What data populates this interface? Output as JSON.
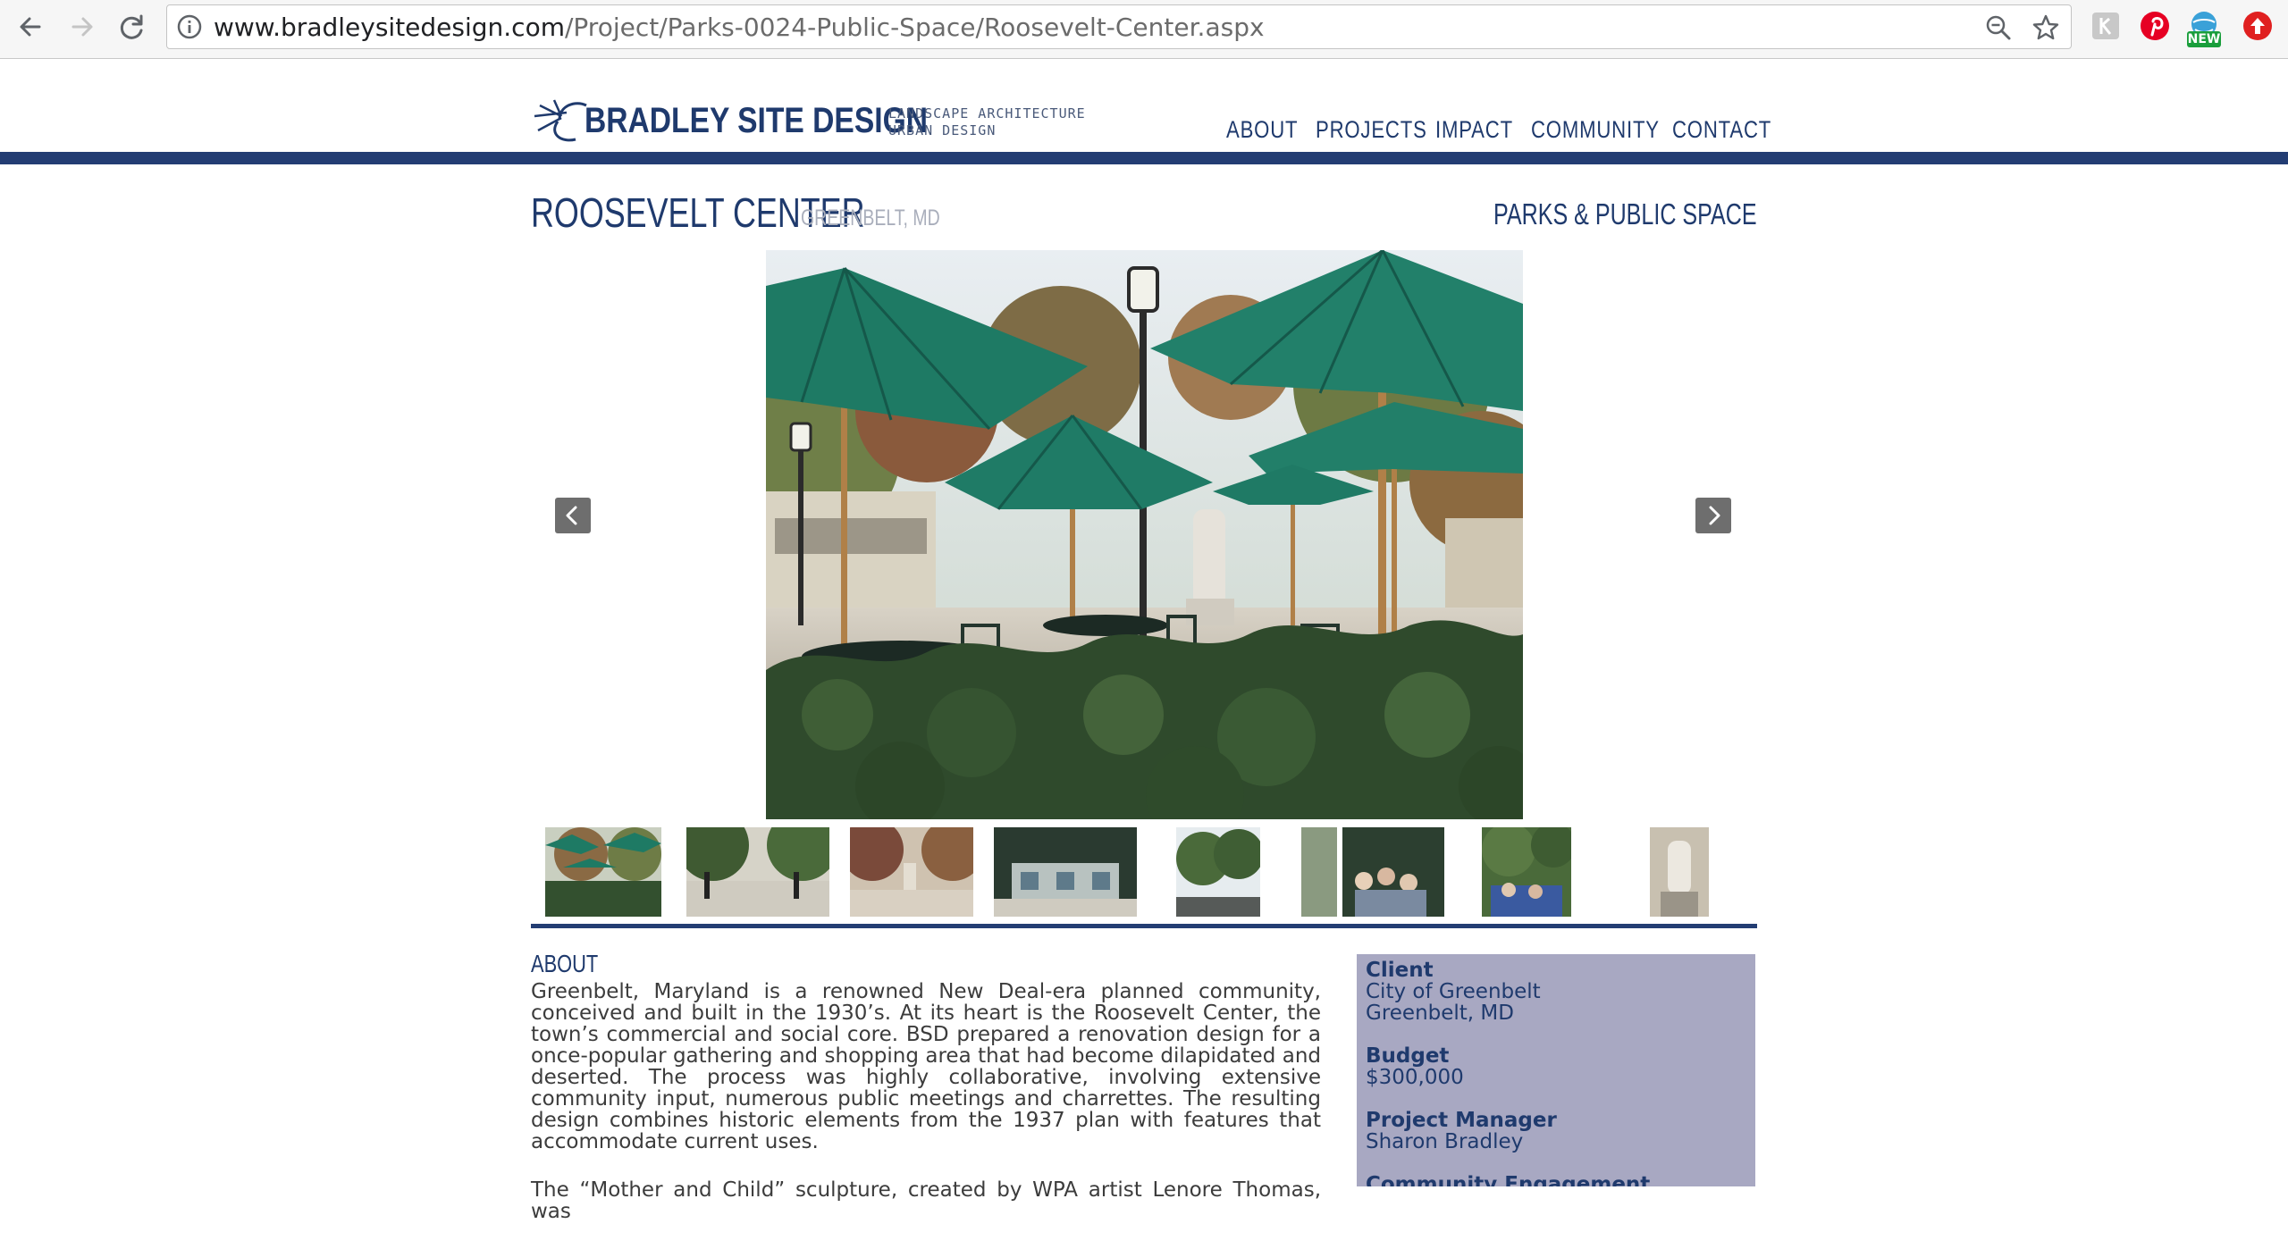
{
  "browser": {
    "url_host": "www.bradleysitedesign.com",
    "url_path": "/Project/Parks-0024-Public-Space/Roosevelt-Center.aspx",
    "extension_badge": "NEW"
  },
  "site": {
    "logo_name": "BRADLEY SITE DESIGN",
    "logo_tag_line1": "LANDSCAPE ARCHITECTURE",
    "logo_tag_line2": "URBAN DESIGN",
    "nav": [
      "ABOUT",
      "PROJECTS",
      "IMPACT",
      "COMMUNITY",
      "CONTACT"
    ],
    "accent_color": "#233d73"
  },
  "project": {
    "title": "ROOSEVELT CENTER",
    "location": "GREENBELT, MD",
    "category": "PARKS & PUBLIC SPACE",
    "slideshow": {
      "current": 1,
      "thumbnail_count": 8
    },
    "about": {
      "heading": "ABOUT",
      "paragraphs": [
        "Greenbelt, Maryland is a renowned New Deal-era planned community, conceived and built in the 1930’s. At its heart is the Roosevelt Center, the town’s commercial and social core. BSD prepared a renovation design for a once-popular gathering and shopping area that had become dilapidated and deserted. The process was highly collaborative, involving extensive community input, numerous public meetings and charrettes. The resulting design combines historic elements from the 1937 plan with features that accommodate current uses.",
        "The “Mother and Child” sculpture, created by WPA artist Lenore Thomas, was"
      ]
    },
    "info": [
      {
        "label": "Client",
        "lines": [
          "City of Greenbelt",
          "Greenbelt, MD"
        ]
      },
      {
        "label": "Budget",
        "lines": [
          "$300,000"
        ]
      },
      {
        "label": "Project Manager",
        "lines": [
          "Sharon Bradley"
        ]
      },
      {
        "label": "Community Engagement",
        "lines": []
      }
    ]
  }
}
